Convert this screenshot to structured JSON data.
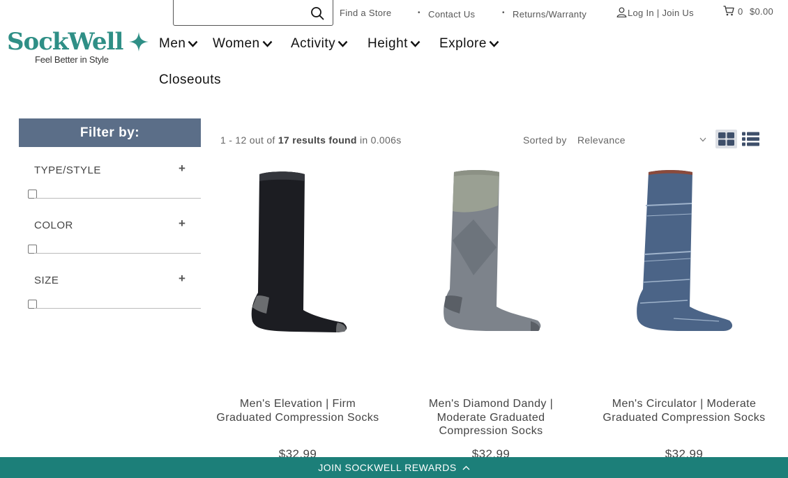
{
  "search": {
    "placeholder": "",
    "value": ""
  },
  "utility_links": {
    "find_store": "Find a Store",
    "contact_us": "Contact Us",
    "returns": "Returns/Warranty",
    "account": "Log In | Join Us",
    "cart_count": "0",
    "cart_total": "$0.00"
  },
  "brand": {
    "name": "SockWell",
    "tagline": "Feel Better in Style",
    "color": "#2f8f86"
  },
  "nav": {
    "items": [
      "Men",
      "Women",
      "Activity",
      "Height",
      "Explore"
    ],
    "closeouts": "Closeouts"
  },
  "filters": {
    "header": "Filter by:",
    "groups": [
      "TYPE/STYLE",
      "COLOR",
      "SIZE"
    ],
    "header_color": "#5b6e88"
  },
  "results": {
    "range": "1 - 12 out of",
    "count": "17 results found",
    "time": "in 0.006s",
    "sort_label": "Sorted by",
    "sort_value": "Relevance"
  },
  "products": [
    {
      "name": "Men's Elevation | Firm Graduated Compression Socks",
      "price": "$32.99",
      "colors": {
        "body": "#1c1d22",
        "accent": "#6b6d70"
      }
    },
    {
      "name": "Men's Diamond Dandy | Moderate Graduated Compression Socks",
      "price": "$32.99",
      "colors": {
        "body": "#7d838b",
        "accent": "#9aa093"
      }
    },
    {
      "name": "Men's Circulator | Moderate Graduated Compression Socks",
      "price": "$32.99",
      "colors": {
        "body": "#4b6487",
        "accent": "#9fb3cb"
      }
    }
  ],
  "rewards": {
    "label": "JOIN SOCKWELL REWARDS",
    "color": "#1c7f79"
  }
}
